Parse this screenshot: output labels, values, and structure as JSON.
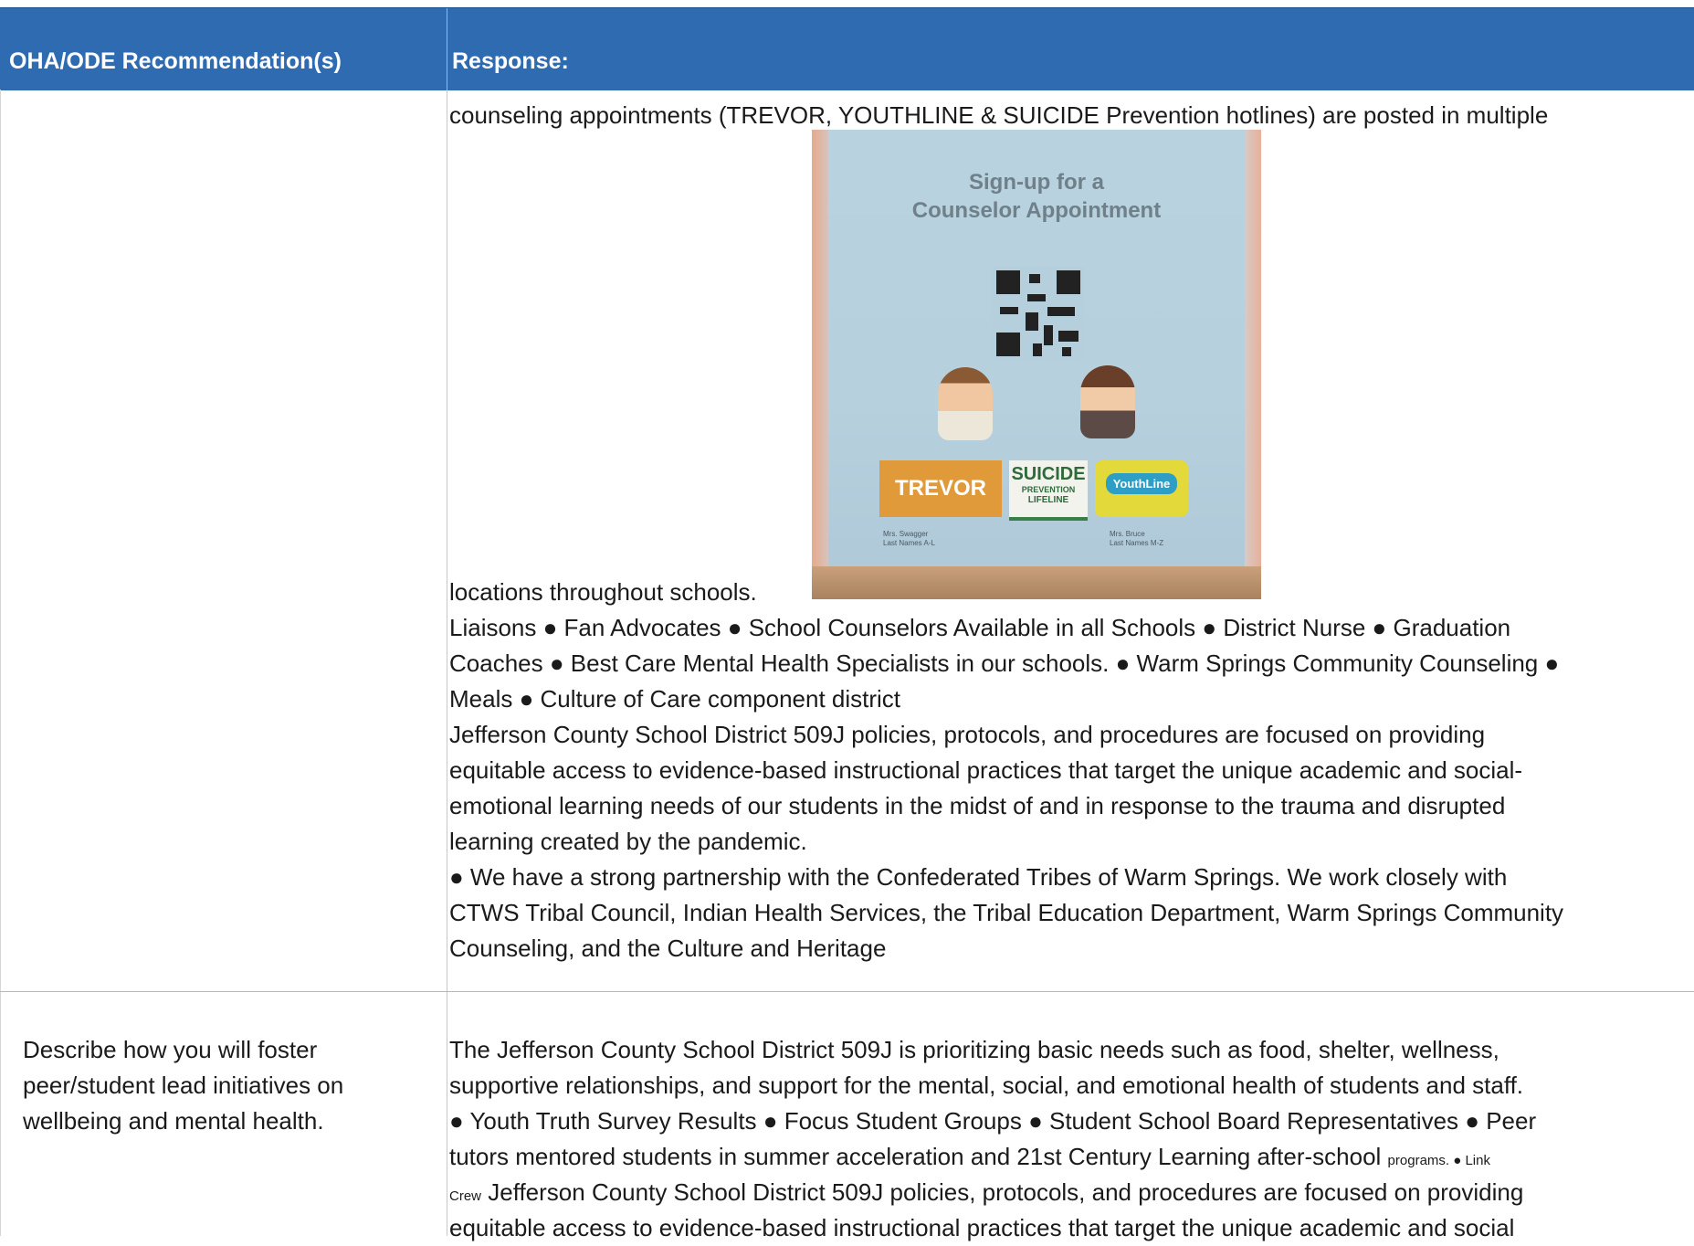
{
  "header": {
    "col1": "OHA/ODE Recommendation(s)",
    "col2": "Response:"
  },
  "row1": {
    "line1": "counseling appointments (TREVOR, YOUTHLINE & SUICIDE Prevention hotlines) are posted in multiple",
    "line2": "locations throughout schools.",
    "line3": "Liaisons ● Fan Advocates ● School Counselors Available in all Schools ● District Nurse ● Graduation",
    "line4": "Coaches ● Best Care Mental Health Specialists in our schools. ● Warm Springs Community Counseling ●",
    "line5": "Meals ● Culture of Care component district",
    "line6": "Jefferson County School District 509J policies, protocols, and procedures are focused on providing",
    "line7": "equitable access to evidence-based instructional practices that target the unique academic and social-",
    "line8": "emotional learning needs of our students in the midst of and in response to the trauma and disrupted",
    "line9": "learning created by the pandemic.",
    "line10": " ● We have a strong partnership with the Confederated Tribes of Warm Springs. We work closely with",
    "line11": "CTWS Tribal Council, Indian Health Services, the Tribal Education Department, Warm Springs Community",
    "line12": "Counseling, and the Culture and Heritage"
  },
  "poster": {
    "title_line1": "Sign-up for a",
    "title_line2": "Counselor Appointment",
    "logo_trevor": "TREVOR",
    "logo_suicide_line1": "SUICIDE",
    "logo_suicide_line2": "PREVENTION",
    "logo_suicide_line3": "LIFELINE",
    "logo_youthline": "YouthLine",
    "sig_left_1": "Mrs. Swagger",
    "sig_left_2": "Last Names A-L",
    "sig_right_1": "Mrs. Bruce",
    "sig_right_2": "Last Names M-Z"
  },
  "row2": {
    "question_line1": "Describe how you will foster",
    "question_line2": "peer/student lead initiatives on",
    "question_line3": "wellbeing and mental health.",
    "line1": "The Jefferson County School District 509J is prioritizing basic needs such as food, shelter, wellness,",
    "line2": "supportive relationships, and support for the mental, social, and emotional health of students and staff.",
    "line3": "● Youth Truth Survey Results ● Focus Student Groups ● Student School Board Representatives ● Peer",
    "line4a": "tutors mentored students in summer acceleration and 21st Century Learning after-school ",
    "line4b": "programs. ● Link",
    "line5a": "Crew",
    "line5b": " Jefferson County School District 509J policies, protocols, and procedures are focused on providing",
    "line6": "equitable access to evidence-based instructional practices that target the unique academic and social"
  }
}
